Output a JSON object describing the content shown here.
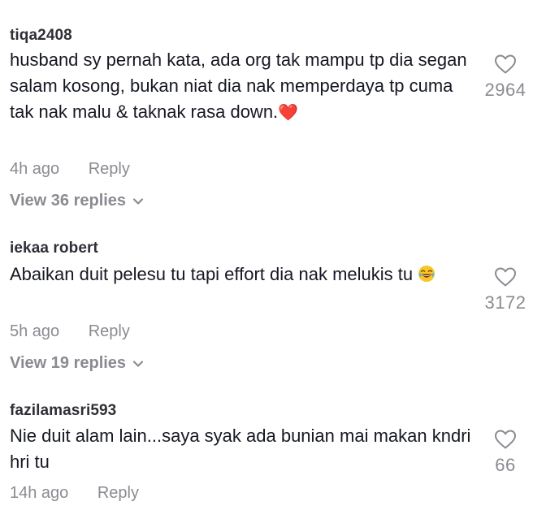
{
  "comments": [
    {
      "username": "tiqa2408",
      "text": "husband sy pernah kata, ada org tak mampu tp dia segan salam kosong, bukan niat dia nak memperdaya tp cuma tak nak malu & taknak rasa down.",
      "emoji": "❤️",
      "time": "4h ago",
      "reply_label": "Reply",
      "view_replies": "View 36 replies",
      "likes": "2964"
    },
    {
      "username": "iekaa robert",
      "text": "Abaikan duit pelesu tu tapi effort dia nak melukis tu",
      "emoji": "😂",
      "time": "5h ago",
      "reply_label": "Reply",
      "view_replies": "View 19 replies",
      "likes": "3172"
    },
    {
      "username": "fazilamasri593",
      "text": "Nie duit alam lain...saya syak ada bunian mai makan kndri hri tu",
      "time": "14h ago",
      "reply_label": "Reply",
      "likes": "66"
    }
  ],
  "icons": {
    "like": "heart-outline-icon",
    "expand": "chevron-down-icon"
  },
  "colors": {
    "text": "#161823",
    "muted": "#8a8b91",
    "username": "#2f2f37",
    "heart_emoji": "#e0112b"
  }
}
